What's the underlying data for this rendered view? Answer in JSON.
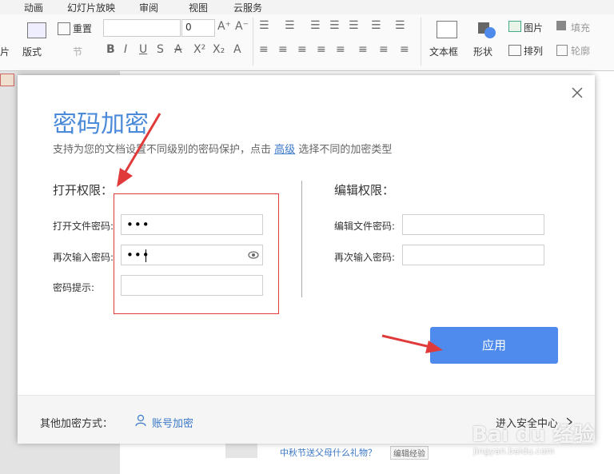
{
  "menu": [
    "动画",
    "幻灯片放映",
    "审阅",
    "视图",
    "云服务"
  ],
  "ribbon": {
    "reset": "重置",
    "layout": "版式",
    "section": "节",
    "slice_left": "片",
    "font_size": "0",
    "textbox": "文本框",
    "shape": "形状",
    "picture": "图片",
    "arrange": "排列",
    "fill": "填充",
    "outline": "轮廓"
  },
  "dialog": {
    "title": "密码加密",
    "subtitle_pre": "支持为您的文档设置不同级别的密码保护，点击",
    "subtitle_link": "高级",
    "subtitle_post": "选择不同的加密类型",
    "open": {
      "heading": "打开权限：",
      "password_label": "打开文件密码:",
      "password_value": "•••",
      "confirm_label": "再次输入密码:",
      "confirm_value": "•••",
      "hint_label": "密码提示:",
      "hint_value": ""
    },
    "edit": {
      "heading": "编辑权限：",
      "password_label": "编辑文件密码:",
      "confirm_label": "再次输入密码:"
    },
    "apply_label": "应用",
    "footer": {
      "other_label": "其他加密方式：",
      "account_label": "账号加密",
      "security_center": "进入安全中心"
    }
  },
  "background": {
    "link_text": "中秋节送父母什么礼物？",
    "tag_text": "编辑经验"
  },
  "watermark": {
    "logo": "Bai du 经验",
    "url": "jingyan.baidu.com"
  },
  "colors": {
    "accent": "#4e8bec",
    "title": "#4a8ad8",
    "annotation": "#e03a3a"
  }
}
